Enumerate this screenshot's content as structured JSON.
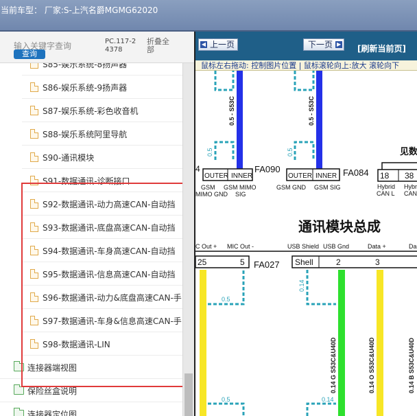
{
  "window": {
    "title": "当前车型： 厂家:S-上汽名爵MGMG62020"
  },
  "search": {
    "placeholder": "输入关键字查询",
    "button_label": "查询",
    "pc_code": "PC.117-24378",
    "fold_all_label": "折叠全部"
  },
  "tree": {
    "items": [
      {
        "label": "S85-娱乐系统-8扬声器",
        "type": "file"
      },
      {
        "label": "S86-娱乐系统-9扬声器",
        "type": "file"
      },
      {
        "label": "S87-娱乐系统-彩色收音机",
        "type": "file"
      },
      {
        "label": "S88-娱乐系统阿里导航",
        "type": "file"
      },
      {
        "label": "S90-通讯模块",
        "type": "file"
      },
      {
        "label": "S91-数据通讯-诊断接口",
        "type": "file"
      },
      {
        "label": "S92-数据通讯-动力高速CAN-自动挡",
        "type": "file"
      },
      {
        "label": "S93-数据通讯-底盘高速CAN-自动挡",
        "type": "file"
      },
      {
        "label": "S94-数据通讯-车身高速CAN-自动挡",
        "type": "file"
      },
      {
        "label": "S95-数据通讯-信息高速CAN-自动挡",
        "type": "file"
      },
      {
        "label": "S96-数据通讯-动力&底盘高速CAN-手",
        "type": "file"
      },
      {
        "label": "S97-数据通讯-车身&信息高速CAN-手",
        "type": "file"
      },
      {
        "label": "S98-数据通讯-LIN",
        "type": "file"
      },
      {
        "label": "连接器端视图",
        "type": "folder"
      },
      {
        "label": "保险丝盒说明",
        "type": "folder"
      },
      {
        "label": "连接器定位图",
        "type": "folder"
      }
    ]
  },
  "viewer": {
    "prev_label": "上一页",
    "next_label": "下一页",
    "refresh_label": "[刷新当前页]",
    "hint": "鼠标左右拖动: 控制图片位置 | 鼠标滚轮向上:放大   滚轮向下"
  },
  "diagram": {
    "title": "通讯模块总成",
    "partial_label": "见数",
    "connectors": {
      "fa090": "FA090",
      "fa084": "FA084",
      "fa027": "FA027"
    },
    "top_labels": {
      "outer1": "OUTER",
      "inner1": "INNER",
      "outer2": "OUTER",
      "inner2": "INNER",
      "pin4": "4",
      "pin18": "18",
      "pin38": "38"
    },
    "signals": {
      "gsm_gnd_left": "GSM",
      "gsm_gnd_left2": "MIMO GND",
      "gsm_mimo": "GSM MIMO",
      "gsm_mimo2": "SIG",
      "gsm_gnd": "GSM GND",
      "gsm_sig": "GSM SIG",
      "hybrid_can_l": "Hybrid",
      "hybrid_can_l2": "CAN L",
      "hybrid_can_h": "Hybr",
      "hybrid_can_h2": "CAN"
    },
    "wire_labels": {
      "w1": "0.5 - S53C",
      "w2": "0.5 - S53C",
      "w3": "0.5",
      "w4": "0.5",
      "w5": "0.5",
      "w6": "0.14",
      "w7": "0.14 G S53C&U40D",
      "w8": "0.14 O S53C&U40D",
      "w9": "0.14 B S53C&U40D",
      "w10": "0.5",
      "w11": "0.14"
    },
    "bottom_header": {
      "c_out": "C Out +",
      "mic_out": "MIC Out -",
      "usb_shield": "USB Shield",
      "usb_gnd": "USB Gnd",
      "data_plus": "Data +",
      "da": "Da"
    },
    "bottom_pins": {
      "p25": "25",
      "p5": "5",
      "shell": "Shell",
      "p2": "2",
      "p3": "3"
    }
  }
}
